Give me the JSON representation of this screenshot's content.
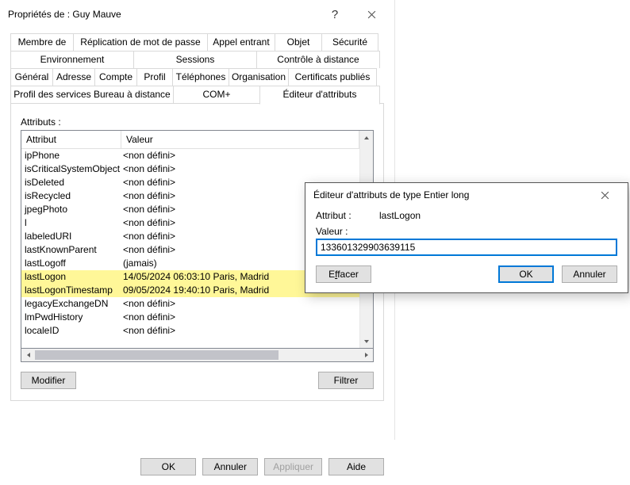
{
  "props_dialog": {
    "title": "Propriétés de : Guy Mauve",
    "help_tooltip": "?",
    "tabs_row1": [
      "Membre de",
      "Réplication de mot de passe",
      "Appel entrant",
      "Objet",
      "Sécurité"
    ],
    "tabs_row2": [
      "Environnement",
      "Sessions",
      "Contrôle à distance"
    ],
    "tabs_row3": [
      "Général",
      "Adresse",
      "Compte",
      "Profil",
      "Téléphones",
      "Organisation",
      "Certificats publiés"
    ],
    "tabs_row4": [
      "Profil des services Bureau à distance",
      "COM+",
      "Éditeur d'attributs"
    ],
    "active_tab": "Éditeur d'attributs",
    "label_attributes": "Attributs :",
    "columns": {
      "attr": "Attribut",
      "val": "Valeur"
    },
    "rows": [
      {
        "attr": "ipPhone",
        "val": "<non défini>",
        "hi": false
      },
      {
        "attr": "isCriticalSystemObject",
        "val": "<non défini>",
        "hi": false
      },
      {
        "attr": "isDeleted",
        "val": "<non défini>",
        "hi": false
      },
      {
        "attr": "isRecycled",
        "val": "<non défini>",
        "hi": false
      },
      {
        "attr": "jpegPhoto",
        "val": "<non défini>",
        "hi": false
      },
      {
        "attr": "l",
        "val": "<non défini>",
        "hi": false
      },
      {
        "attr": "labeledURI",
        "val": "<non défini>",
        "hi": false
      },
      {
        "attr": "lastKnownParent",
        "val": "<non défini>",
        "hi": false
      },
      {
        "attr": "lastLogoff",
        "val": "(jamais)",
        "hi": false
      },
      {
        "attr": "lastLogon",
        "val": "14/05/2024 06:03:10 Paris, Madrid",
        "hi": true
      },
      {
        "attr": "lastLogonTimestamp",
        "val": "09/05/2024 19:40:10 Paris, Madrid",
        "hi": true
      },
      {
        "attr": "legacyExchangeDN",
        "val": "<non défini>",
        "hi": false
      },
      {
        "attr": "lmPwdHistory",
        "val": "<non défini>",
        "hi": false
      },
      {
        "attr": "localeID",
        "val": "<non défini>",
        "hi": false
      }
    ],
    "btn_modify": "Modifier",
    "btn_filter": "Filtrer",
    "footer": {
      "ok": "OK",
      "cancel": "Annuler",
      "apply": "Appliquer",
      "help": "Aide"
    }
  },
  "int_dialog": {
    "title": "Éditeur d'attributs de type Entier long",
    "label_attr": "Attribut :",
    "attr_value": "lastLogon",
    "label_value": "Valeur :",
    "value": "133601329903639115",
    "btn_clear_pre": "E",
    "btn_clear_u": "f",
    "btn_clear_post": "facer",
    "btn_ok": "OK",
    "btn_cancel": "Annuler"
  }
}
